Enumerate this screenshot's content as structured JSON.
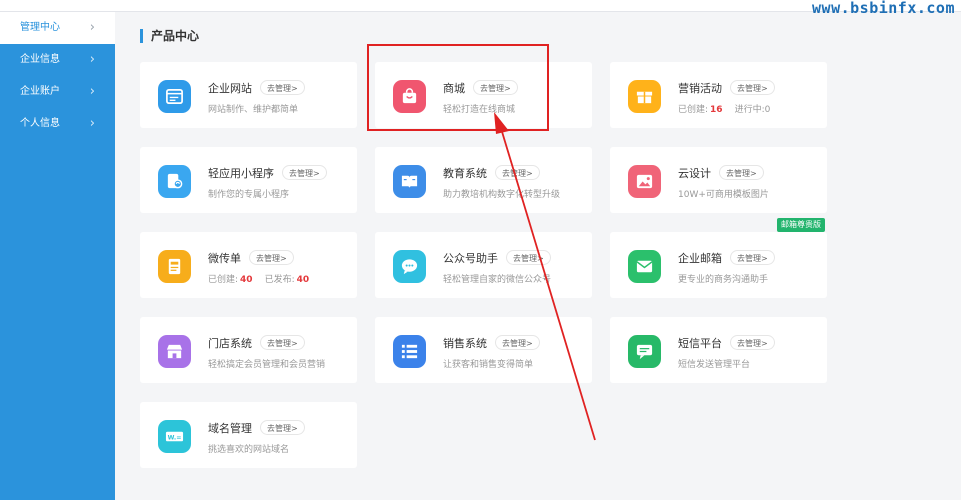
{
  "watermark": "www.bsbinfx.com",
  "sidebar": {
    "items": [
      {
        "label": "管理中心",
        "active": true
      },
      {
        "label": "企业信息"
      },
      {
        "label": "企业账户"
      },
      {
        "label": "个人信息"
      }
    ],
    "chevron": "›"
  },
  "section": {
    "title": "产品中心"
  },
  "manage_label": "去管理>",
  "cards": {
    "website": {
      "name": "企业网站",
      "desc": "网站制作、维护都简单",
      "icon": "browser-icon"
    },
    "mall": {
      "name": "商城",
      "desc": "轻松打造在线商城",
      "icon": "shopping-bag-icon"
    },
    "marketing": {
      "name": "营销活动",
      "created_label": "已创建:",
      "created_count": "16",
      "ongoing_label": "进行中:",
      "ongoing_count": "0",
      "icon": "gift-icon"
    },
    "miniapp": {
      "name": "轻应用小程序",
      "desc": "制作您的专属小程序",
      "icon": "mini-program-icon"
    },
    "education": {
      "name": "教育系统",
      "desc": "助力教培机构数字化转型升级",
      "icon": "book-icon"
    },
    "design": {
      "name": "云设计",
      "desc": "10W+可商用模板图片",
      "icon": "image-icon"
    },
    "microflyer": {
      "name": "微传单",
      "created_label": "已创建:",
      "created_count": "40",
      "published_label": "已发布:",
      "published_count": "40",
      "icon": "flyer-icon"
    },
    "wechat": {
      "name": "公众号助手",
      "desc": "轻松管理自家的微信公众号",
      "icon": "chat-bubble-icon"
    },
    "email": {
      "name": "企业邮箱",
      "desc": "更专业的商务沟通助手",
      "badge": "邮箱尊贵版",
      "icon": "mail-icon"
    },
    "store": {
      "name": "门店系统",
      "desc": "轻松搞定会员管理和会员营销",
      "icon": "storefront-icon"
    },
    "sales": {
      "name": "销售系统",
      "desc": "让获客和销售变得简单",
      "icon": "list-icon"
    },
    "sms": {
      "name": "短信平台",
      "desc": "短信发送管理平台",
      "icon": "message-icon"
    },
    "domain": {
      "name": "域名管理",
      "desc": "挑选喜欢的网站域名",
      "icon": "domain-icon",
      "icon_text": "W.="
    }
  },
  "colors": {
    "sidebar": "#2b93dc",
    "highlight": "#e02222",
    "badge": "#22b46d",
    "count": "#e4393c"
  }
}
